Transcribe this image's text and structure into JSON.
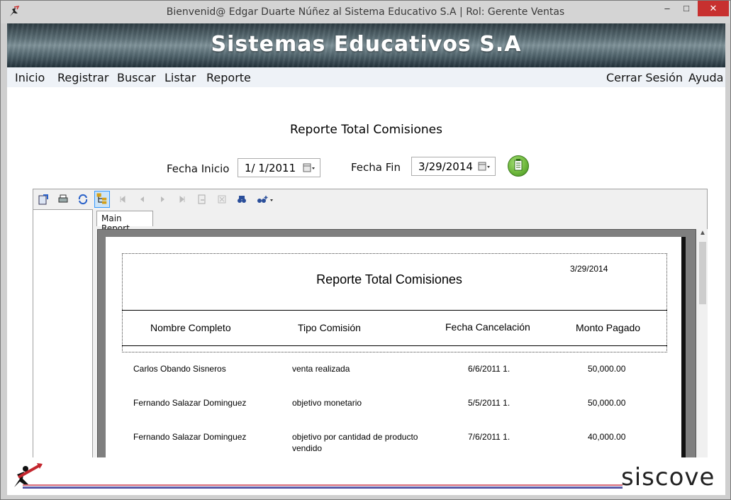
{
  "window": {
    "title": "Bienvenid@ Edgar Duarte Núñez al Sistema Educativo S.A  |  Rol: Gerente Ventas",
    "minimize": "–",
    "maximize": "□",
    "close": "✕"
  },
  "banner": {
    "title": "Sistemas Educativos S.A"
  },
  "menu": {
    "left": [
      "Inicio",
      "Registrar",
      "Buscar",
      "Listar",
      "Reporte"
    ],
    "right": [
      "Cerrar Sesión",
      "Ayuda"
    ]
  },
  "page": {
    "title": "Reporte Total Comisiones",
    "fecha_inicio_label": "Fecha Inicio",
    "fecha_inicio_value": "1/  1/2011",
    "fecha_fin_label": "Fecha Fin",
    "fecha_fin_value": "3/29/2014"
  },
  "viewer": {
    "tab_label": "Main Report",
    "toolbar_icons": [
      "export-icon",
      "print-icon",
      "refresh-icon",
      "group-tree-icon",
      "first-page-icon",
      "previous-page-icon",
      "next-page-icon",
      "last-page-icon",
      "goto-page-icon",
      "close-view-icon",
      "find-icon",
      "zoom-icon"
    ]
  },
  "report": {
    "date": "3/29/2014",
    "title": "Reporte Total Comisiones",
    "columns": [
      "Nombre Completo",
      "Tipo Comisión",
      "Fecha Cancelación",
      "Monto Pagado"
    ],
    "rows": [
      {
        "nombre": "Carlos Obando Sisneros",
        "tipo": "venta realizada",
        "tipo2": "",
        "fecha": "6/6/2011  1.",
        "monto": "50,000.00"
      },
      {
        "nombre": "Fernando Salazar Dominguez",
        "tipo": "objetivo monetario",
        "tipo2": "",
        "fecha": "5/5/2011  1.",
        "monto": "50,000.00"
      },
      {
        "nombre": "Fernando Salazar Dominguez",
        "tipo": "objetivo por cantidad de producto",
        "tipo2": "vendido",
        "fecha": "7/6/2011  1.",
        "monto": "40,000.00"
      }
    ]
  },
  "footer": {
    "brand": "siscove"
  },
  "colors": {
    "close_button": "#c7302f",
    "menubar_bg": "#eef2f7",
    "generate_button": "#6fb83d",
    "footer_red": "#d86a78",
    "footer_blue": "#5a5aa8"
  }
}
